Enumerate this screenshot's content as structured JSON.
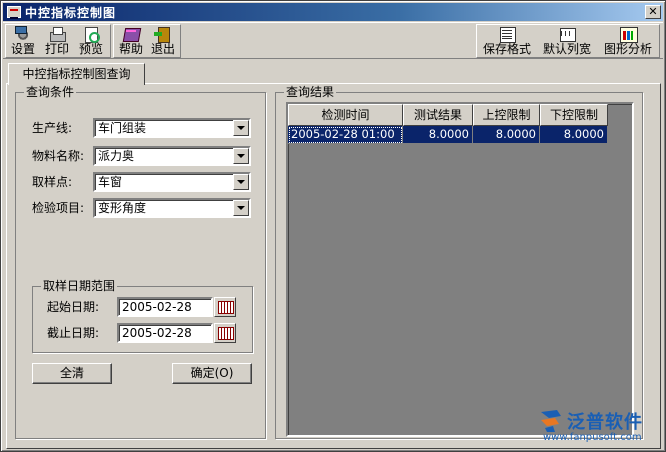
{
  "window": {
    "title": "中控指标控制图",
    "close_glyph": "✕"
  },
  "toolbar": {
    "left": [
      {
        "label": "设置",
        "icon": "settings-icon"
      },
      {
        "label": "打印",
        "icon": "print-icon"
      },
      {
        "label": "预览",
        "icon": "preview-icon"
      },
      {
        "label": "帮助",
        "icon": "help-icon"
      },
      {
        "label": "退出",
        "icon": "exit-icon"
      }
    ],
    "right": [
      {
        "label": "保存格式",
        "icon": "save-format-icon"
      },
      {
        "label": "默认列宽",
        "icon": "column-width-icon"
      },
      {
        "label": "图形分析",
        "icon": "chart-analysis-icon"
      }
    ]
  },
  "tab": {
    "label": "中控指标控制图查询"
  },
  "conditions": {
    "title": "查询条件",
    "production_line": {
      "label": "生产线:",
      "value": "车门组装"
    },
    "material_name": {
      "label": "物料名称:",
      "value": "派力奥"
    },
    "sampling_point": {
      "label": "取样点:",
      "value": "车窗"
    },
    "inspection_item": {
      "label": "检验项目:",
      "value": "变形角度"
    },
    "date_range": {
      "title": "取样日期范围",
      "start": {
        "label": "起始日期:",
        "value": "2005-02-28"
      },
      "end": {
        "label": "截止日期:",
        "value": "2005-02-28"
      }
    },
    "clear_label": "全清",
    "confirm_label": "确定(O)"
  },
  "results": {
    "title": "查询结果",
    "columns": [
      "检测时间",
      "测试结果",
      "上控限制",
      "下控限制"
    ],
    "rows": [
      [
        "2005-02-28 01:00",
        "8.0000",
        "8.0000",
        "8.0000"
      ]
    ]
  },
  "watermark": {
    "name": "泛普软件",
    "url": "www.fanpusoft.com"
  }
}
